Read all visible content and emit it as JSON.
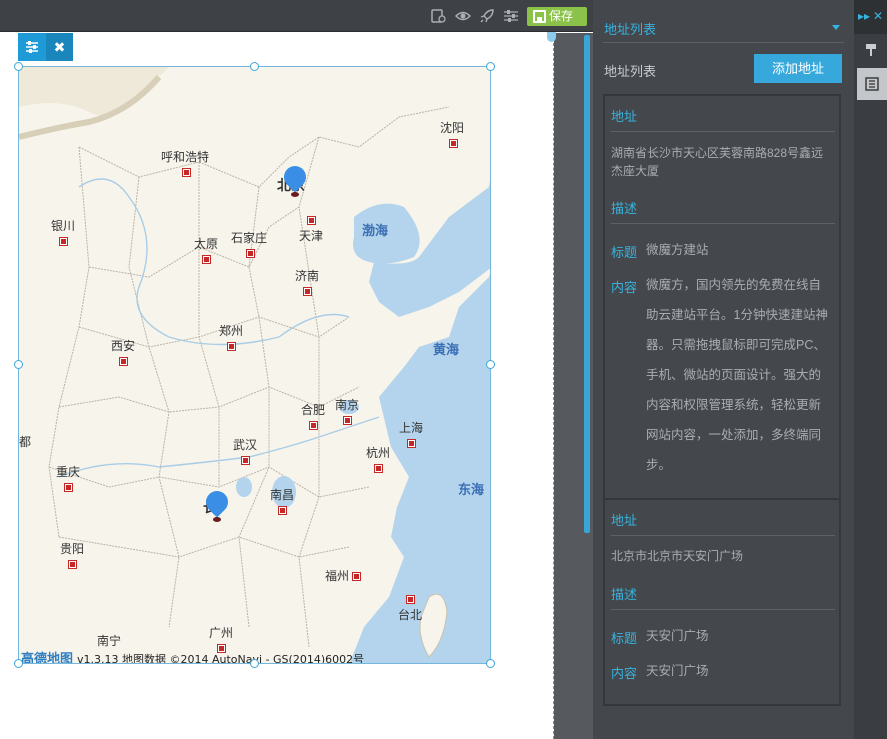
{
  "toolbar": {
    "icons": [
      "page-settings-icon",
      "preview-eye-icon",
      "publish-rocket-icon",
      "settings-sliders-icon"
    ],
    "save_label": "保存"
  },
  "map": {
    "cities": [
      {
        "name": "沈阳"
      },
      {
        "name": "呼和浩特"
      },
      {
        "name": "北京"
      },
      {
        "name": "天津"
      },
      {
        "name": "银川"
      },
      {
        "name": "太原"
      },
      {
        "name": "石家庄"
      },
      {
        "name": "济南"
      },
      {
        "name": "郑州"
      },
      {
        "name": "西安"
      },
      {
        "name": "合肥"
      },
      {
        "name": "南京"
      },
      {
        "name": "上海"
      },
      {
        "name": "武汉"
      },
      {
        "name": "杭州"
      },
      {
        "name": "重庆"
      },
      {
        "name": "南昌"
      },
      {
        "name": "长"
      },
      {
        "name": "贵阳"
      },
      {
        "name": "福州"
      },
      {
        "name": "台北"
      },
      {
        "name": "广州"
      },
      {
        "name": "南宁"
      },
      {
        "name": "都"
      }
    ],
    "seas": [
      "渤海",
      "黄海",
      "东海"
    ],
    "brand": "高德地图",
    "attribution": "v1.3.13 地图数据 ©2014 AutoNavi - GS(2014)6002号"
  },
  "panel": {
    "header_title": "地址列表",
    "list_label": "地址列表",
    "add_button": "添加地址",
    "addresses": [
      {
        "address_header": "地址",
        "address": "湖南省长沙市天心区芙蓉南路828号鑫远杰座大厦",
        "desc_header": "描述",
        "title_key": "标题",
        "title_value": "微魔方建站",
        "content_key": "内容",
        "content_lines": [
          "微魔方，国内领先的免费在线自",
          "助云建站平台。1分钟快速建站神",
          "器。只需拖拽鼠标即可完成PC、",
          "手机、微站的页面设计。强大的",
          "内容和权限管理系统，轻松更新",
          "网站内容，一处添加，多终端同",
          "步。"
        ]
      },
      {
        "address_header": "地址",
        "address": "北京市北京市天安门广场",
        "desc_header": "描述",
        "title_key": "标题",
        "title_value": "天安门广场",
        "content_key": "内容",
        "content_value": "天安门广场"
      }
    ]
  },
  "colors": {
    "accent": "#37b3df",
    "save_green": "#8bc34a",
    "panel_bg": "#44474b",
    "toolbar_bg": "#3e4145",
    "pin_blue": "#3a8ee6",
    "city_red": "#c62828",
    "sea_label": "#3b6fb5"
  }
}
